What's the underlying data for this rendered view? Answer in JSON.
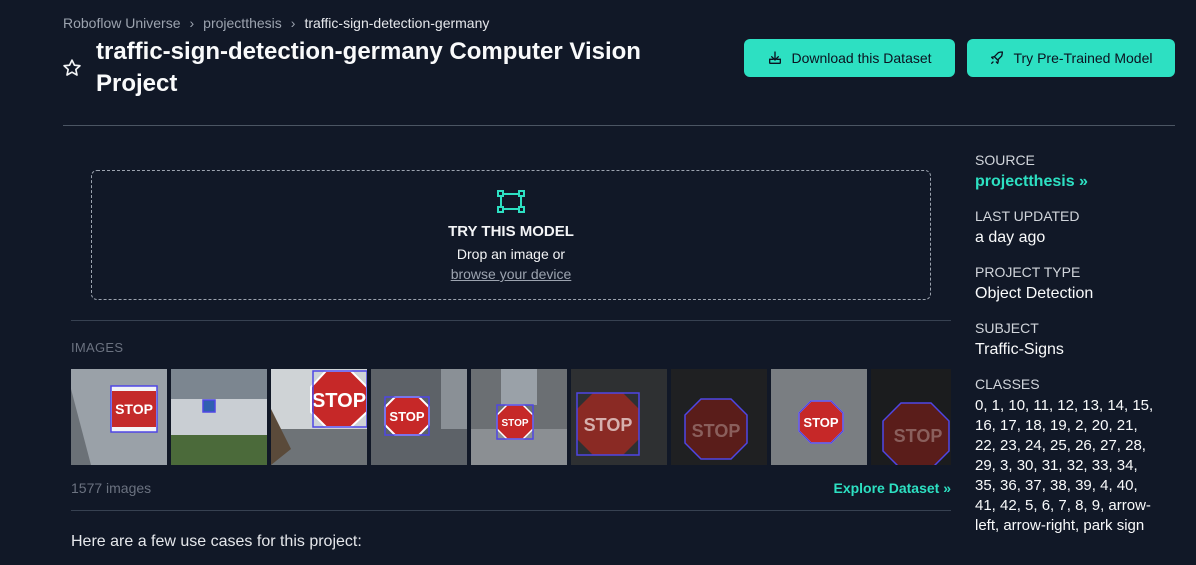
{
  "breadcrumb": {
    "items": [
      "Roboflow Universe",
      "projectthesis",
      "traffic-sign-detection-germany"
    ]
  },
  "header": {
    "title": "traffic-sign-detection-germany Computer Vision Project",
    "download_label": "Download this Dataset",
    "try_label": "Try Pre-Trained Model"
  },
  "dropzone": {
    "title": "TRY THIS MODEL",
    "subtitle": "Drop an image or",
    "link": "browse your device"
  },
  "images": {
    "label": "IMAGES",
    "count": "1577 images",
    "explore": "Explore Dataset",
    "thumb_text": "STOP"
  },
  "usecases": {
    "intro": "Here are a few use cases for this project:"
  },
  "sidebar": {
    "source_label": "SOURCE",
    "source_value": "projectthesis",
    "updated_label": "LAST UPDATED",
    "updated_value": "a day ago",
    "type_label": "PROJECT TYPE",
    "type_value": "Object Detection",
    "subject_label": "SUBJECT",
    "subject_value": "Traffic-Signs",
    "classes_label": "CLASSES",
    "classes_value": "0, 1, 10, 11, 12, 13, 14, 15, 16, 17, 18, 19, 2, 20, 21, 22, 23, 24, 25, 26, 27, 28, 29, 3, 30, 31, 32, 33, 34, 35, 36, 37, 38, 39, 4, 40, 41, 42, 5, 6, 7, 8, 9, arrow-left, arrow-right, park sign"
  },
  "colors": {
    "background": "#111827",
    "accent": "#2de0c2",
    "bbox": "#4f46e5"
  }
}
